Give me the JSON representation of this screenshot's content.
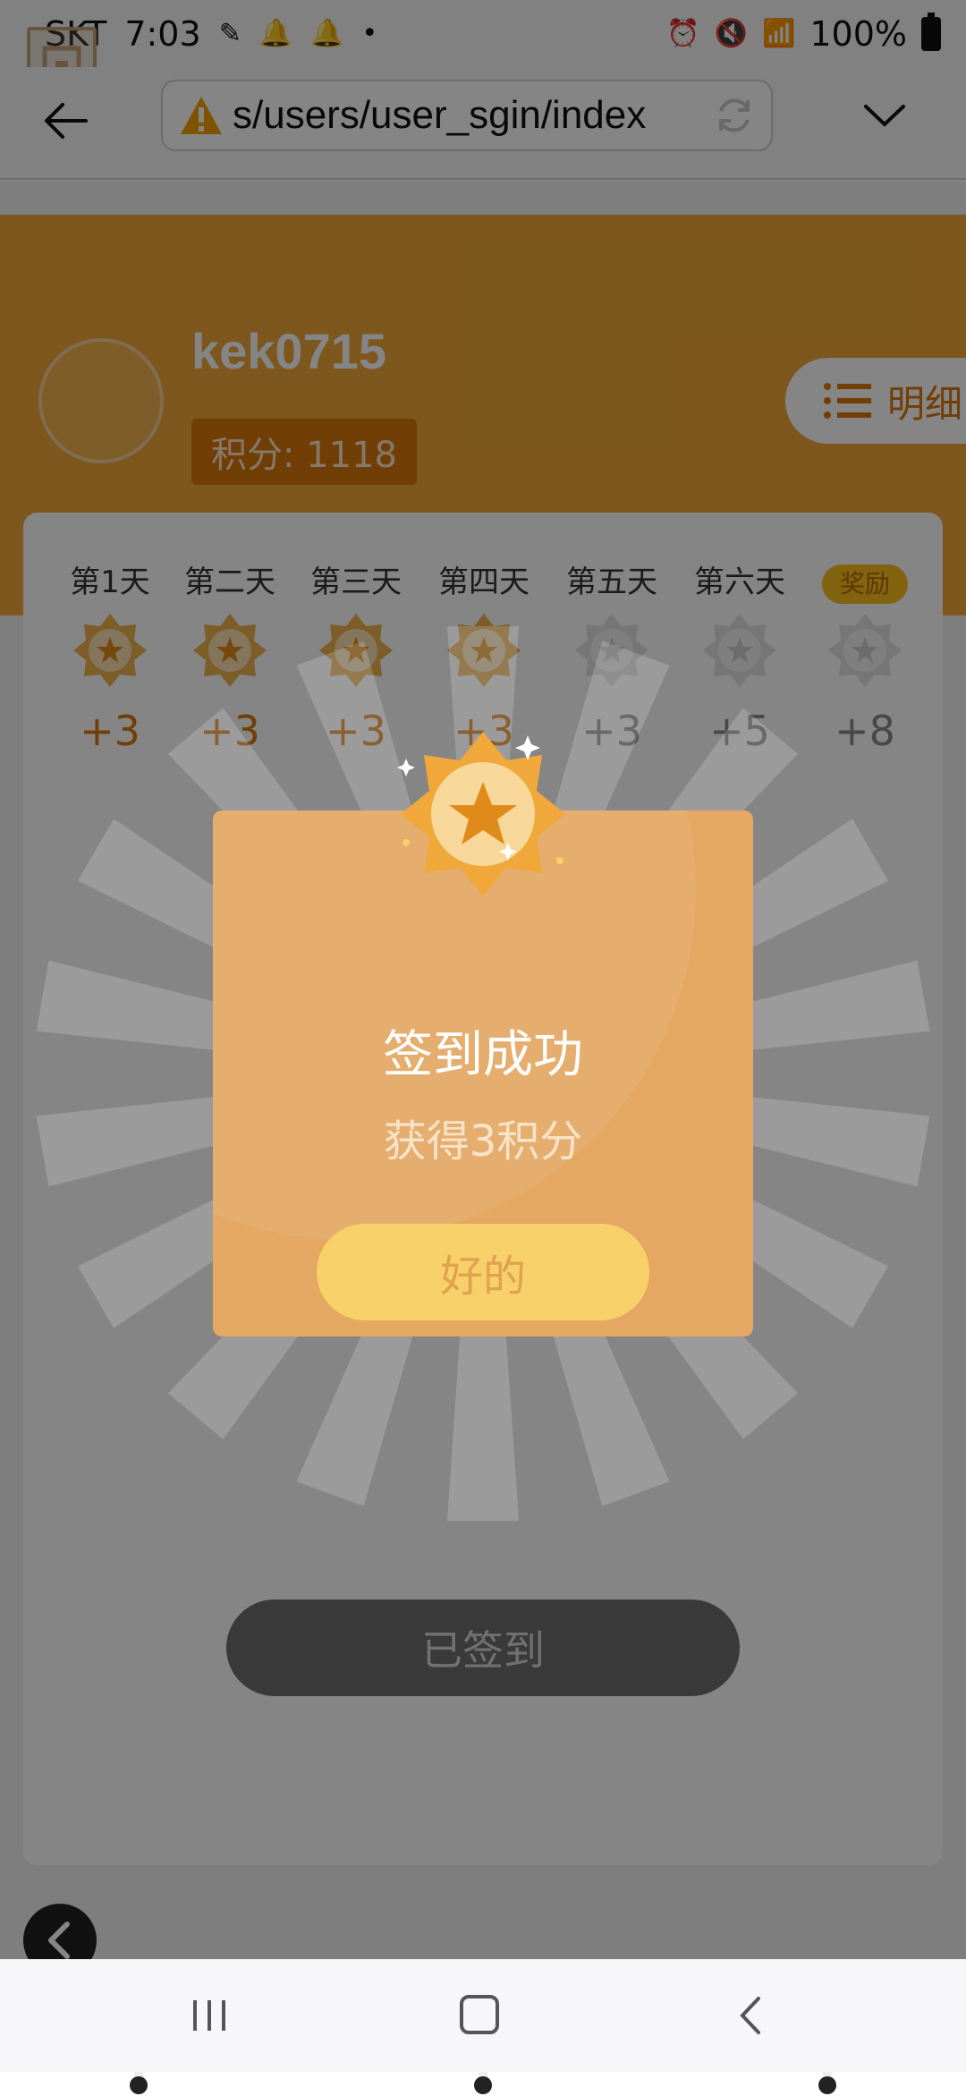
{
  "status_bar": {
    "time": "7:03",
    "carrier_prefix": "SKT",
    "battery": "100%"
  },
  "browser": {
    "url": "s/users/user_sgin/index"
  },
  "profile": {
    "username": "kek0715",
    "points_label": "积分: 1118",
    "details_label": "明细"
  },
  "checkin": {
    "days": [
      {
        "label": "第1天",
        "points": "+3",
        "checked": true
      },
      {
        "label": "第二天",
        "points": "+3",
        "checked": true
      },
      {
        "label": "第三天",
        "points": "+3",
        "checked": true
      },
      {
        "label": "第四天",
        "points": "+3",
        "checked": true
      },
      {
        "label": "第五天",
        "points": "+3",
        "checked": false
      },
      {
        "label": "第六天",
        "points": "+5",
        "checked": false
      },
      {
        "label": "奖励",
        "points": "+8",
        "checked": false
      }
    ],
    "signed_button": "已签到"
  },
  "modal": {
    "title": "签到成功",
    "subtitle": "获得3积分",
    "ok_label": "好的"
  },
  "colors": {
    "accent": "#f0a83a",
    "accent_dark": "#d9780a",
    "modal_bg": "#e4a862",
    "ok_button": "#f7d06a"
  },
  "icons": [
    "back-arrow-icon",
    "warning-icon",
    "reload-icon",
    "chevron-down-icon",
    "list-icon",
    "star-badge-icon",
    "medal-icon",
    "recents-icon",
    "home-icon",
    "nav-back-icon"
  ]
}
